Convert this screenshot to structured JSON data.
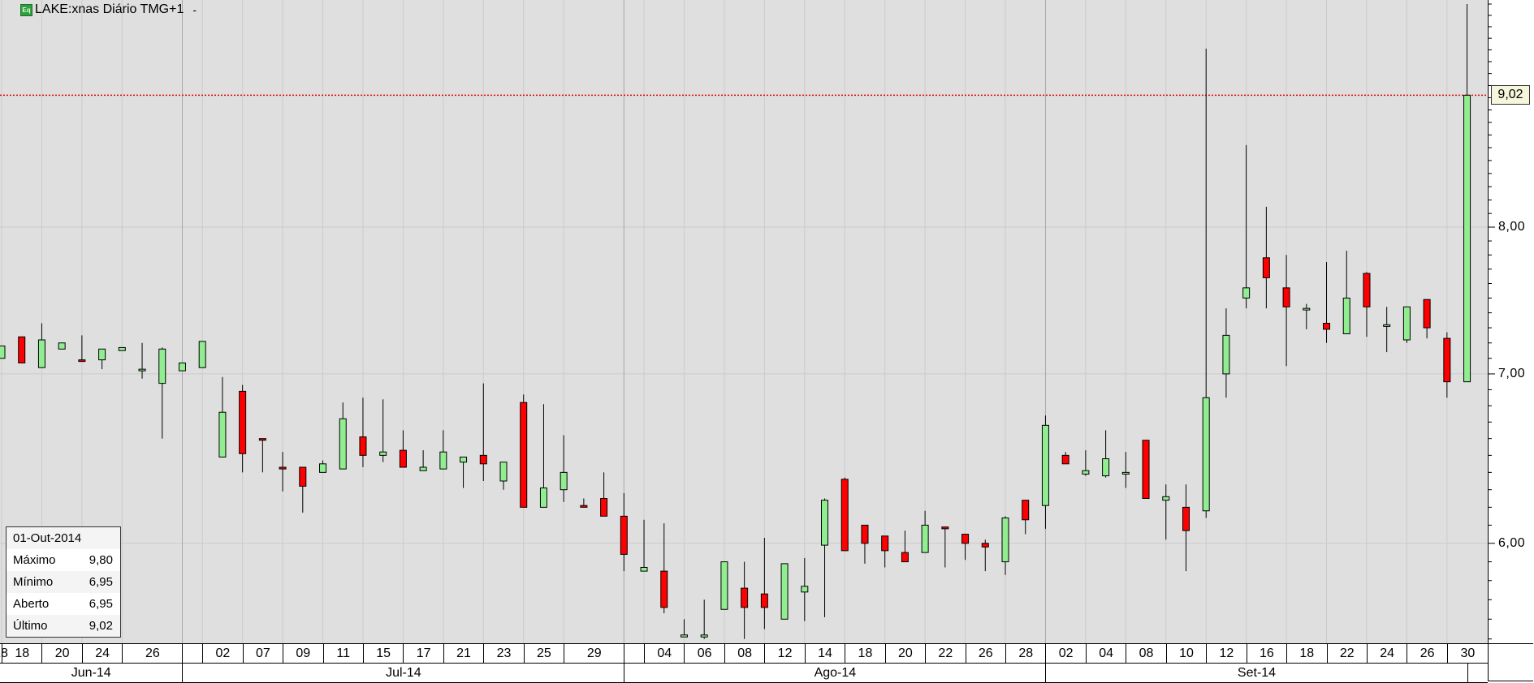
{
  "header": {
    "symbol_title": "LAKE:xnas Diário TMG+1",
    "dropdown": "-",
    "icon_text": "Eq"
  },
  "info_box": {
    "date": "01-Out-2014",
    "rows": [
      {
        "label": "Máximo",
        "value": "9,80"
      },
      {
        "label": "Mínimo",
        "value": "6,95"
      },
      {
        "label": "Aberto",
        "value": "6,95"
      },
      {
        "label": "Último",
        "value": "9,02"
      }
    ]
  },
  "price_axis": {
    "ticks": [
      {
        "value": 6,
        "label": "6,00"
      },
      {
        "value": 7,
        "label": "7,00"
      },
      {
        "value": 8,
        "label": "8,00"
      }
    ],
    "last_price": 9.02,
    "last_price_label": "9,02"
  },
  "colors": {
    "up": "#90ee90",
    "down": "#ff0000",
    "background": "#dfdfdf",
    "last_line": "#e00000"
  },
  "chart_data": {
    "type": "candlestick",
    "title": "LAKE:xnas Diário TMG+1",
    "scale": "log",
    "ylim": [
      5.47,
      9.83
    ],
    "candles": [
      [
        "2014-06-17",
        7.1,
        7.18,
        7.1,
        7.18
      ],
      [
        "2014-06-18",
        7.24,
        7.24,
        7.07,
        7.07
      ],
      [
        "2014-06-19",
        7.04,
        7.33,
        7.04,
        7.22
      ],
      [
        "2014-06-20",
        7.16,
        7.2,
        7.16,
        7.2
      ],
      [
        "2014-06-23",
        7.09,
        7.25,
        7.08,
        7.08
      ],
      [
        "2014-06-24",
        7.09,
        7.16,
        7.03,
        7.16
      ],
      [
        "2014-06-25",
        7.15,
        7.17,
        7.15,
        7.17
      ],
      [
        "2014-06-26",
        7.02,
        7.2,
        6.97,
        7.03
      ],
      [
        "2014-06-27",
        6.94,
        7.17,
        6.6,
        7.16
      ],
      [
        "2014-06-30",
        7.02,
        7.07,
        7.02,
        7.07
      ],
      [
        "2014-07-01",
        7.04,
        7.21,
        7.04,
        7.21
      ],
      [
        "2014-07-02",
        6.49,
        6.98,
        6.49,
        6.76
      ],
      [
        "2014-07-03",
        6.89,
        6.93,
        6.4,
        6.51
      ],
      [
        "2014-07-07",
        6.6,
        6.6,
        6.4,
        6.59
      ],
      [
        "2014-07-08",
        6.43,
        6.52,
        6.29,
        6.42
      ],
      [
        "2014-07-09",
        6.43,
        6.43,
        6.17,
        6.32
      ],
      [
        "2014-07-10",
        6.4,
        6.47,
        6.4,
        6.45
      ],
      [
        "2014-07-11",
        6.42,
        6.82,
        6.42,
        6.72
      ],
      [
        "2014-07-14",
        6.61,
        6.85,
        6.43,
        6.5
      ],
      [
        "2014-07-15",
        6.5,
        6.84,
        6.46,
        6.52
      ],
      [
        "2014-07-16",
        6.53,
        6.65,
        6.43,
        6.43
      ],
      [
        "2014-07-17",
        6.41,
        6.53,
        6.41,
        6.43
      ],
      [
        "2014-07-18",
        6.42,
        6.65,
        6.42,
        6.52
      ],
      [
        "2014-07-21",
        6.46,
        6.49,
        6.31,
        6.49
      ],
      [
        "2014-07-22",
        6.5,
        6.94,
        6.35,
        6.45
      ],
      [
        "2014-07-23",
        6.35,
        6.46,
        6.3,
        6.46
      ],
      [
        "2014-07-24",
        6.82,
        6.87,
        6.2,
        6.2
      ],
      [
        "2014-07-25",
        6.2,
        6.81,
        6.2,
        6.31
      ],
      [
        "2014-07-28",
        6.3,
        6.62,
        6.23,
        6.4
      ],
      [
        "2014-07-29",
        6.21,
        6.25,
        6.2,
        6.2
      ],
      [
        "2014-07-30",
        6.25,
        6.4,
        6.15,
        6.15
      ],
      [
        "2014-07-31",
        6.15,
        6.28,
        5.85,
        5.94
      ],
      [
        "2014-08-01",
        5.85,
        6.13,
        5.85,
        5.87
      ],
      [
        "2014-08-04",
        5.85,
        6.11,
        5.63,
        5.66
      ],
      [
        "2014-08-05",
        5.51,
        5.6,
        5.51,
        5.52
      ],
      [
        "2014-08-06",
        5.51,
        5.7,
        5.5,
        5.52
      ],
      [
        "2014-08-07",
        5.65,
        5.9,
        5.65,
        5.9
      ],
      [
        "2014-08-08",
        5.76,
        5.9,
        5.5,
        5.66
      ],
      [
        "2014-08-11",
        5.73,
        6.03,
        5.55,
        5.66
      ],
      [
        "2014-08-12",
        5.6,
        5.89,
        5.6,
        5.89
      ],
      [
        "2014-08-13",
        5.74,
        5.92,
        5.59,
        5.77
      ],
      [
        "2014-08-14",
        5.99,
        6.25,
        5.61,
        6.24
      ],
      [
        "2014-08-15",
        6.36,
        6.37,
        5.96,
        5.96
      ],
      [
        "2014-08-18",
        6.1,
        6.1,
        5.89,
        6.0
      ],
      [
        "2014-08-19",
        6.04,
        6.04,
        5.87,
        5.96
      ],
      [
        "2014-08-20",
        5.95,
        6.07,
        5.9,
        5.9
      ],
      [
        "2014-08-21",
        5.95,
        6.18,
        5.95,
        6.1
      ],
      [
        "2014-08-22",
        6.09,
        6.09,
        5.87,
        6.08
      ],
      [
        "2014-08-25",
        6.05,
        6.05,
        5.91,
        6.0
      ],
      [
        "2014-08-26",
        6.0,
        6.02,
        5.85,
        5.98
      ],
      [
        "2014-08-27",
        5.9,
        6.15,
        5.83,
        6.14
      ],
      [
        "2014-08-28",
        6.24,
        6.24,
        6.05,
        6.13
      ],
      [
        "2014-08-29",
        6.21,
        6.74,
        6.08,
        6.68
      ],
      [
        "2014-09-02",
        6.5,
        6.52,
        6.45,
        6.45
      ],
      [
        "2014-09-03",
        6.39,
        6.53,
        6.38,
        6.41
      ],
      [
        "2014-09-04",
        6.38,
        6.65,
        6.37,
        6.48
      ],
      [
        "2014-09-05",
        6.39,
        6.52,
        6.31,
        6.4
      ],
      [
        "2014-09-08",
        6.59,
        6.59,
        6.25,
        6.25
      ],
      [
        "2014-09-09",
        6.24,
        6.33,
        6.02,
        6.26
      ],
      [
        "2014-09-10",
        6.2,
        6.33,
        5.85,
        6.07
      ],
      [
        "2014-09-11",
        6.18,
        9.41,
        6.14,
        6.85
      ],
      [
        "2014-09-12",
        7.0,
        7.43,
        6.85,
        7.25
      ],
      [
        "2014-09-15",
        7.5,
        8.62,
        7.43,
        7.57
      ],
      [
        "2014-09-16",
        7.78,
        8.15,
        7.43,
        7.64
      ],
      [
        "2014-09-17",
        7.57,
        7.8,
        7.05,
        7.44
      ],
      [
        "2014-09-18",
        7.42,
        7.46,
        7.29,
        7.43
      ],
      [
        "2014-09-19",
        7.33,
        7.75,
        7.2,
        7.29
      ],
      [
        "2014-09-22",
        7.26,
        7.83,
        7.26,
        7.5
      ],
      [
        "2014-09-23",
        7.67,
        7.68,
        7.24,
        7.44
      ],
      [
        "2014-09-24",
        7.31,
        7.44,
        7.14,
        7.32
      ],
      [
        "2014-09-25",
        7.22,
        7.44,
        7.2,
        7.44
      ],
      [
        "2014-09-26",
        7.49,
        7.49,
        7.23,
        7.3
      ],
      [
        "2014-09-29",
        7.23,
        7.27,
        6.85,
        6.95
      ],
      [
        "2014-09-30",
        6.95,
        9.8,
        6.95,
        9.02
      ]
    ],
    "day_labels": [
      {
        "label": "18",
        "index": 1
      },
      {
        "label": "20",
        "index": 3
      },
      {
        "label": "24",
        "index": 5
      },
      {
        "label": "26",
        "index": 7
      },
      {
        "label": "02",
        "index": 11
      },
      {
        "label": "07",
        "index": 13
      },
      {
        "label": "09",
        "index": 15
      },
      {
        "label": "11",
        "index": 17
      },
      {
        "label": "15",
        "index": 19
      },
      {
        "label": "17",
        "index": 21
      },
      {
        "label": "21",
        "index": 23
      },
      {
        "label": "23",
        "index": 25
      },
      {
        "label": "25",
        "index": 27
      },
      {
        "label": "29",
        "index": 29
      },
      {
        "label": "04",
        "index": 33
      },
      {
        "label": "06",
        "index": 35
      },
      {
        "label": "08",
        "index": 37
      },
      {
        "label": "12",
        "index": 39
      },
      {
        "label": "14",
        "index": 41
      },
      {
        "label": "18",
        "index": 43
      },
      {
        "label": "20",
        "index": 45
      },
      {
        "label": "22",
        "index": 47
      },
      {
        "label": "26",
        "index": 49
      },
      {
        "label": "28",
        "index": 51
      },
      {
        "label": "02",
        "index": 53
      },
      {
        "label": "04",
        "index": 55
      },
      {
        "label": "08",
        "index": 57
      },
      {
        "label": "10",
        "index": 59
      },
      {
        "label": "12",
        "index": 61
      },
      {
        "label": "16",
        "index": 63
      },
      {
        "label": "18",
        "index": 65
      },
      {
        "label": "22",
        "index": 67
      },
      {
        "label": "24",
        "index": 69
      },
      {
        "label": "26",
        "index": 71
      },
      {
        "label": "30",
        "index": 73
      }
    ],
    "months": [
      {
        "label": "Jun-14",
        "last_index": 9
      },
      {
        "label": "Jul-14",
        "last_index": 31
      },
      {
        "label": "Ago-14",
        "last_index": 52
      },
      {
        "label": "Set-14",
        "last_index": 73
      }
    ]
  }
}
